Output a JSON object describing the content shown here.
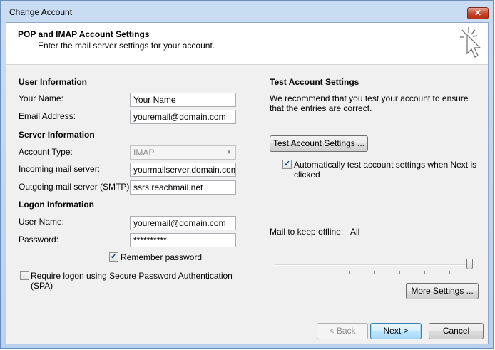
{
  "window": {
    "title": "Change Account",
    "close_label": "✕"
  },
  "header": {
    "title": "POP and IMAP Account Settings",
    "subtitle": "Enter the mail server settings for your account."
  },
  "user_info": {
    "heading": "User Information",
    "name_label": "Your Name:",
    "name_value": "Your Name",
    "email_label": "Email Address:",
    "email_value": "youremail@domain.com"
  },
  "server_info": {
    "heading": "Server Information",
    "account_type_label": "Account Type:",
    "account_type_value": "IMAP",
    "incoming_label": "Incoming mail server:",
    "incoming_value": "yourmailserver.domain.com",
    "outgoing_label": "Outgoing mail server (SMTP):",
    "outgoing_value": "ssrs.reachmail.net"
  },
  "logon_info": {
    "heading": "Logon Information",
    "username_label": "User Name:",
    "username_value": "youremail@domain.com",
    "password_label": "Password:",
    "password_value": "**********",
    "remember_label": "Remember password",
    "remember_checked": true,
    "spa_label": "Require logon using Secure Password Authentication (SPA)",
    "spa_checked": false
  },
  "test": {
    "heading": "Test Account Settings",
    "description": "We recommend that you test your account to ensure that the entries are correct.",
    "button_label": "Test Account Settings ...",
    "auto_label": "Automatically test account settings when Next is clicked",
    "auto_checked": true
  },
  "offline": {
    "label": "Mail to keep offline:",
    "value": "All",
    "level": 1.0
  },
  "buttons": {
    "more_settings": "More Settings ...",
    "back": "< Back",
    "next": "Next >",
    "cancel": "Cancel"
  },
  "colors": {
    "frame": "#b9d1ec",
    "panel": "#f0f0f0",
    "close": "#c7412a"
  },
  "icons": {
    "header": "cursor-click-icon",
    "check": "check-icon",
    "combo_arrow": "chevron-down-icon"
  }
}
